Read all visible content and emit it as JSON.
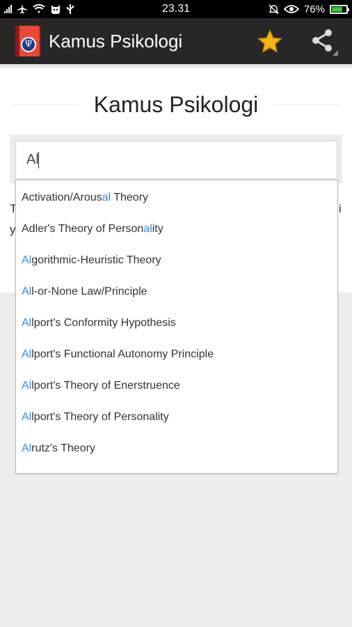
{
  "status_bar": {
    "time": "23.31",
    "battery_percent": "76%",
    "battery_level": 0.76
  },
  "app_bar": {
    "title": "Kamus Psikologi",
    "icon_glyph": "Ψ",
    "favorite_icon": "star-icon",
    "share_icon": "share-icon"
  },
  "page": {
    "title": "Kamus Psikologi"
  },
  "search": {
    "value": "Al",
    "query": "al"
  },
  "background_text": {
    "left_line1": "T",
    "left_line2": "y",
    "right_line1": "i"
  },
  "suggestions": [
    "Activation/Arousal Theory",
    "Adler's Theory of Personality",
    "Algorithmic-Heuristic Theory",
    "All-or-None Law/Principle",
    "Allport's Conformity Hypothesis",
    "Allport's Functional Autonomy Principle",
    "Allport's Theory of Enerstruence",
    "Allport's Theory of Personality",
    "Alrutz's Theory"
  ],
  "colors": {
    "app_bar": "#272727",
    "highlight": "#2f8fe0",
    "star": "#f5b414"
  }
}
